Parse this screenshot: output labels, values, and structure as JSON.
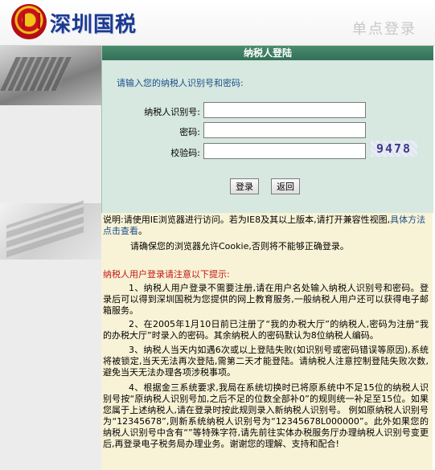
{
  "header": {
    "logo_text": "深圳国税",
    "sso_label": "单点登录"
  },
  "login": {
    "title": "纳税人登陆",
    "prompt": "请输入您的纳税人识别号和密码:",
    "fields": [
      {
        "label": "纳税人识别号:",
        "value": ""
      },
      {
        "label": "密码:",
        "value": ""
      },
      {
        "label": "校验码:",
        "value": ""
      }
    ],
    "captcha": "9478",
    "submit_label": "登录",
    "back_label": "返回"
  },
  "notice": {
    "browser_note_prefix": "说明:请使用IE浏览器进行访问。若为IE8及其以上版本,请打开兼容性视图,",
    "browser_note_link": "具体方法点击查看",
    "browser_note_suffix": "。",
    "cookie_note": "请确保您的浏览器允许Cookie,否则将不能够正确登录。",
    "warning_title": "纳税人用户登录请注意以下提示:",
    "paragraphs": [
      "1、纳税人用户登录不需要注册,请在用户名处输入纳税人识别号和密码。登录后可以得到深圳国税为您提供的网上教育服务,一般纳税人用户还可以获得电子邮箱服务。",
      "2、在2005年1月10日前已注册了“我的办税大厅”的纳税人,密码为注册“我的办税大厅”时录入的密码。其余纳税人的密码默认为8位纳税人编码。",
      "3、纳税人当天内如遇6次或以上登陆失败(如识别号或密码错误等原因),系统将被锁定,当天无法再次登陆,需第二天才能登陆。请纳税人注意控制登陆失败次数,避免当天无法办理各项涉税事项。",
      "4、根据金三系统要求,我局在系统切换时已将原系统中不足15位的纳税人识别号按“原纳税人识别号加,之后不足的位数全部补0”的规则统一补足至15位。如果您属于上述纳税人,请在登录时按此规则录入新纳税人识别号。 例如原纳税人识别号为“12345678”,则新系统纳税人识别号为“12345678L000000”。此外如果您的纳税人识别号中含有“”等特殊字符,请先前往实体办税服务厅办理纳税人识别号变更后,再登录电子税务局办理业务。谢谢您的理解、支持和配合!"
    ]
  }
}
